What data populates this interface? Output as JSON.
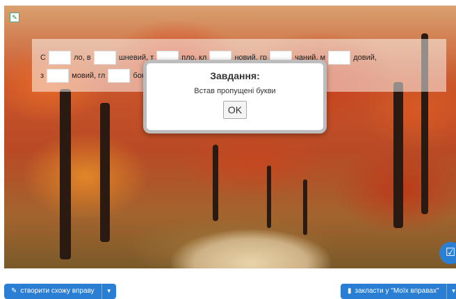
{
  "exercise": {
    "line1": [
      {
        "text": "С"
      },
      {
        "text": "ло, в"
      },
      {
        "text": "шневий, т"
      },
      {
        "text": "пло, кл"
      },
      {
        "text": "новий, гр"
      },
      {
        "text": "чаний, м"
      },
      {
        "text": "довий,"
      }
    ],
    "line2": [
      {
        "text": "з"
      },
      {
        "text": "мовий, гл"
      },
      {
        "text": "бок"
      }
    ]
  },
  "modal": {
    "title": "Завдання:",
    "instruction": "Встав пропущені букви",
    "ok_label": "OK"
  },
  "toolbar": {
    "create_label": "створити схожу вправу",
    "bookmark_label": "закласти у \"Моїх вправах\""
  },
  "icons": {
    "create": "edit-icon",
    "bookmark": "bookmark-icon",
    "check": "check-square-icon",
    "corner": "app-icon"
  },
  "colors": {
    "accent": "#2a7fd4"
  }
}
